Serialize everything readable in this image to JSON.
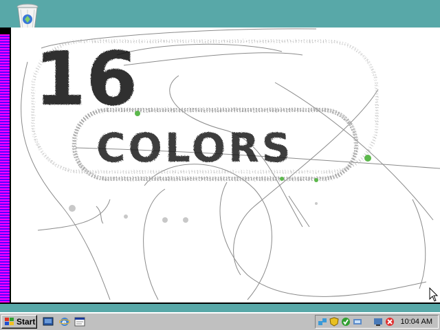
{
  "desktop": {
    "icons": [
      {
        "name": "recycle-bin-icon"
      }
    ],
    "colors": {
      "background": "#58a8a8"
    }
  },
  "paint_canvas": {
    "drawing_big_text": "16",
    "drawing_word": "COLORS"
  },
  "taskbar": {
    "start_label": "Start",
    "quick_launch": [
      "show-desktop-icon",
      "internet-explorer-icon",
      "window-icon"
    ],
    "tray_icons": [
      "network-icon",
      "shield-icon",
      "security-icon",
      "network-connection-icon",
      "volume-icon",
      "update-icon"
    ],
    "clock": "10:04 AM"
  }
}
